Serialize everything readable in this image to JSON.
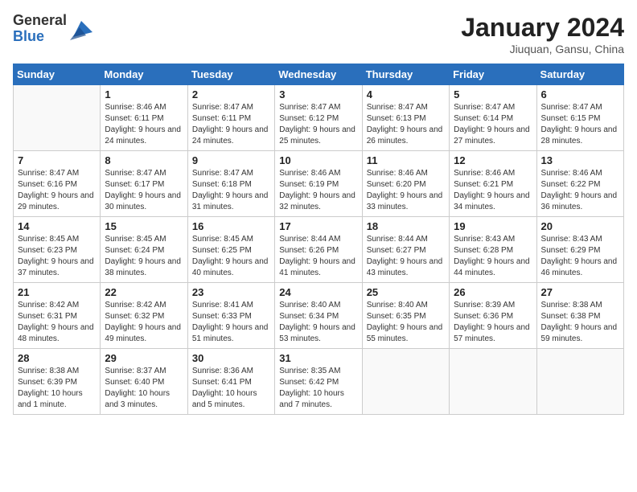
{
  "header": {
    "logo_general": "General",
    "logo_blue": "Blue",
    "month_title": "January 2024",
    "location": "Jiuquan, Gansu, China"
  },
  "weekdays": [
    "Sunday",
    "Monday",
    "Tuesday",
    "Wednesday",
    "Thursday",
    "Friday",
    "Saturday"
  ],
  "weeks": [
    [
      {
        "day": "",
        "sunrise": "",
        "sunset": "",
        "daylight": ""
      },
      {
        "day": "1",
        "sunrise": "Sunrise: 8:46 AM",
        "sunset": "Sunset: 6:11 PM",
        "daylight": "Daylight: 9 hours and 24 minutes."
      },
      {
        "day": "2",
        "sunrise": "Sunrise: 8:47 AM",
        "sunset": "Sunset: 6:11 PM",
        "daylight": "Daylight: 9 hours and 24 minutes."
      },
      {
        "day": "3",
        "sunrise": "Sunrise: 8:47 AM",
        "sunset": "Sunset: 6:12 PM",
        "daylight": "Daylight: 9 hours and 25 minutes."
      },
      {
        "day": "4",
        "sunrise": "Sunrise: 8:47 AM",
        "sunset": "Sunset: 6:13 PM",
        "daylight": "Daylight: 9 hours and 26 minutes."
      },
      {
        "day": "5",
        "sunrise": "Sunrise: 8:47 AM",
        "sunset": "Sunset: 6:14 PM",
        "daylight": "Daylight: 9 hours and 27 minutes."
      },
      {
        "day": "6",
        "sunrise": "Sunrise: 8:47 AM",
        "sunset": "Sunset: 6:15 PM",
        "daylight": "Daylight: 9 hours and 28 minutes."
      }
    ],
    [
      {
        "day": "7",
        "sunrise": "Sunrise: 8:47 AM",
        "sunset": "Sunset: 6:16 PM",
        "daylight": "Daylight: 9 hours and 29 minutes."
      },
      {
        "day": "8",
        "sunrise": "Sunrise: 8:47 AM",
        "sunset": "Sunset: 6:17 PM",
        "daylight": "Daylight: 9 hours and 30 minutes."
      },
      {
        "day": "9",
        "sunrise": "Sunrise: 8:47 AM",
        "sunset": "Sunset: 6:18 PM",
        "daylight": "Daylight: 9 hours and 31 minutes."
      },
      {
        "day": "10",
        "sunrise": "Sunrise: 8:46 AM",
        "sunset": "Sunset: 6:19 PM",
        "daylight": "Daylight: 9 hours and 32 minutes."
      },
      {
        "day": "11",
        "sunrise": "Sunrise: 8:46 AM",
        "sunset": "Sunset: 6:20 PM",
        "daylight": "Daylight: 9 hours and 33 minutes."
      },
      {
        "day": "12",
        "sunrise": "Sunrise: 8:46 AM",
        "sunset": "Sunset: 6:21 PM",
        "daylight": "Daylight: 9 hours and 34 minutes."
      },
      {
        "day": "13",
        "sunrise": "Sunrise: 8:46 AM",
        "sunset": "Sunset: 6:22 PM",
        "daylight": "Daylight: 9 hours and 36 minutes."
      }
    ],
    [
      {
        "day": "14",
        "sunrise": "Sunrise: 8:45 AM",
        "sunset": "Sunset: 6:23 PM",
        "daylight": "Daylight: 9 hours and 37 minutes."
      },
      {
        "day": "15",
        "sunrise": "Sunrise: 8:45 AM",
        "sunset": "Sunset: 6:24 PM",
        "daylight": "Daylight: 9 hours and 38 minutes."
      },
      {
        "day": "16",
        "sunrise": "Sunrise: 8:45 AM",
        "sunset": "Sunset: 6:25 PM",
        "daylight": "Daylight: 9 hours and 40 minutes."
      },
      {
        "day": "17",
        "sunrise": "Sunrise: 8:44 AM",
        "sunset": "Sunset: 6:26 PM",
        "daylight": "Daylight: 9 hours and 41 minutes."
      },
      {
        "day": "18",
        "sunrise": "Sunrise: 8:44 AM",
        "sunset": "Sunset: 6:27 PM",
        "daylight": "Daylight: 9 hours and 43 minutes."
      },
      {
        "day": "19",
        "sunrise": "Sunrise: 8:43 AM",
        "sunset": "Sunset: 6:28 PM",
        "daylight": "Daylight: 9 hours and 44 minutes."
      },
      {
        "day": "20",
        "sunrise": "Sunrise: 8:43 AM",
        "sunset": "Sunset: 6:29 PM",
        "daylight": "Daylight: 9 hours and 46 minutes."
      }
    ],
    [
      {
        "day": "21",
        "sunrise": "Sunrise: 8:42 AM",
        "sunset": "Sunset: 6:31 PM",
        "daylight": "Daylight: 9 hours and 48 minutes."
      },
      {
        "day": "22",
        "sunrise": "Sunrise: 8:42 AM",
        "sunset": "Sunset: 6:32 PM",
        "daylight": "Daylight: 9 hours and 49 minutes."
      },
      {
        "day": "23",
        "sunrise": "Sunrise: 8:41 AM",
        "sunset": "Sunset: 6:33 PM",
        "daylight": "Daylight: 9 hours and 51 minutes."
      },
      {
        "day": "24",
        "sunrise": "Sunrise: 8:40 AM",
        "sunset": "Sunset: 6:34 PM",
        "daylight": "Daylight: 9 hours and 53 minutes."
      },
      {
        "day": "25",
        "sunrise": "Sunrise: 8:40 AM",
        "sunset": "Sunset: 6:35 PM",
        "daylight": "Daylight: 9 hours and 55 minutes."
      },
      {
        "day": "26",
        "sunrise": "Sunrise: 8:39 AM",
        "sunset": "Sunset: 6:36 PM",
        "daylight": "Daylight: 9 hours and 57 minutes."
      },
      {
        "day": "27",
        "sunrise": "Sunrise: 8:38 AM",
        "sunset": "Sunset: 6:38 PM",
        "daylight": "Daylight: 9 hours and 59 minutes."
      }
    ],
    [
      {
        "day": "28",
        "sunrise": "Sunrise: 8:38 AM",
        "sunset": "Sunset: 6:39 PM",
        "daylight": "Daylight: 10 hours and 1 minute."
      },
      {
        "day": "29",
        "sunrise": "Sunrise: 8:37 AM",
        "sunset": "Sunset: 6:40 PM",
        "daylight": "Daylight: 10 hours and 3 minutes."
      },
      {
        "day": "30",
        "sunrise": "Sunrise: 8:36 AM",
        "sunset": "Sunset: 6:41 PM",
        "daylight": "Daylight: 10 hours and 5 minutes."
      },
      {
        "day": "31",
        "sunrise": "Sunrise: 8:35 AM",
        "sunset": "Sunset: 6:42 PM",
        "daylight": "Daylight: 10 hours and 7 minutes."
      },
      {
        "day": "",
        "sunrise": "",
        "sunset": "",
        "daylight": ""
      },
      {
        "day": "",
        "sunrise": "",
        "sunset": "",
        "daylight": ""
      },
      {
        "day": "",
        "sunrise": "",
        "sunset": "",
        "daylight": ""
      }
    ]
  ]
}
